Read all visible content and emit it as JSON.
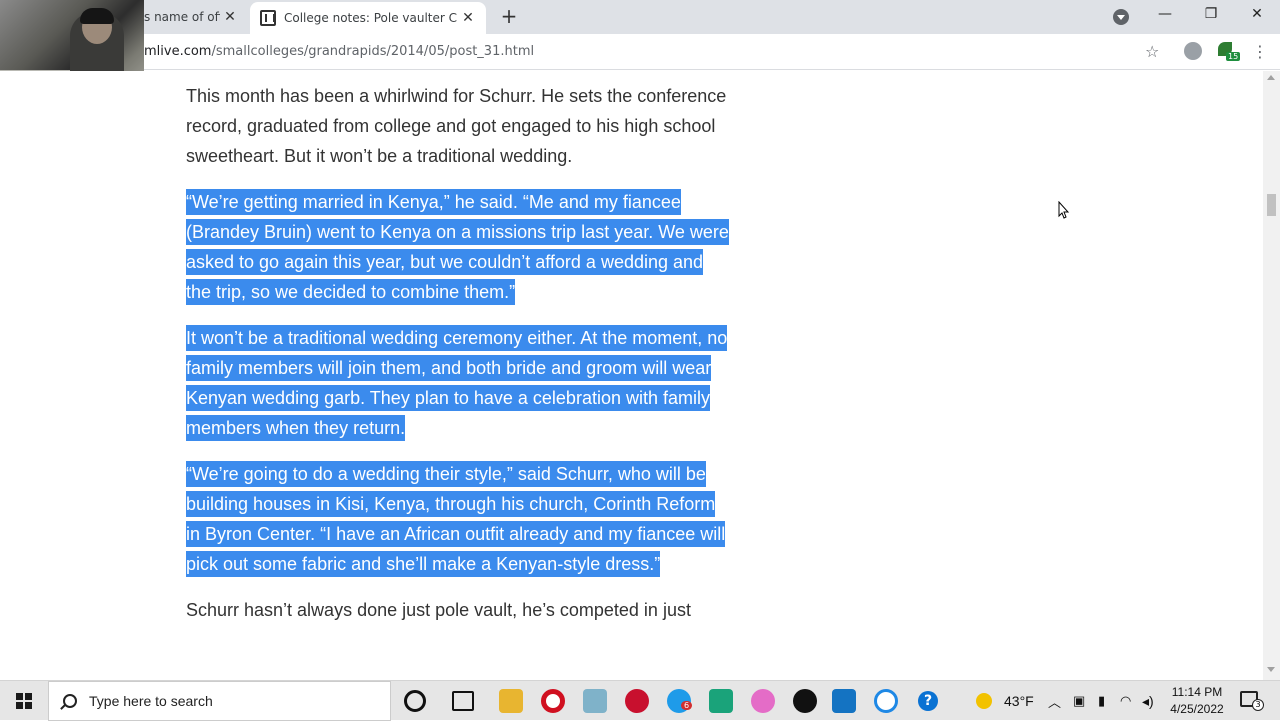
{
  "browser": {
    "tabs": [
      {
        "title": "s name of offi",
        "active": false
      },
      {
        "title": "College notes: Pole vaulter Chris",
        "active": true
      }
    ],
    "url_host": "mlive.com",
    "url_path": "/smallcolleges/grandrapids/2014/05/post_31.html",
    "extension_badge": "15"
  },
  "article": {
    "paragraphs": [
      {
        "text": "This month has been a whirlwind for Schurr. He sets the conference record, graduated from college and got engaged to his high school sweetheart. But it won’t be a traditional wedding.",
        "selected": false
      },
      {
        "text": "“We’re getting married in Kenya,” he said. “Me and my fiancee (Brandey Bruin) went to Kenya on a missions trip last year. We were asked to go again this year, but we couldn’t afford a wedding and the trip, so we decided to combine them.”",
        "selected": true
      },
      {
        "text": "It won’t be a traditional wedding ceremony either. At the moment, no family members will join them, and both bride and groom will wear Kenyan wedding garb. They plan to have a celebration with family members when they return.",
        "selected": true
      },
      {
        "text": "“We’re going to do a wedding their style,” said Schurr, who will be building houses in Kisi, Kenya, through his church, Corinth Reform in Byron Center. “I have an African outfit already and my fiancee will pick out some fabric and she’ll make a Kenyan-style dress.”",
        "selected": true
      },
      {
        "text": "Schurr hasn’t always done just pole vault, he’s competed in just",
        "selected": false
      }
    ]
  },
  "taskbar": {
    "search_placeholder": "Type here to search",
    "weather": "43°F",
    "time": "11:14 PM",
    "date": "4/25/2022",
    "notification_count": "3",
    "app_badge": "6"
  },
  "colors": {
    "selection": "#3b8bed",
    "tab_strip": "#dee1e6",
    "taskbar": "#e6e6e6"
  }
}
